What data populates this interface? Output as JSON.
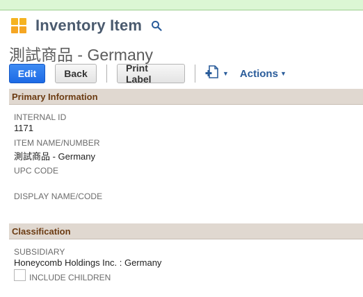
{
  "header": {
    "record_type": "Inventory Item",
    "record_title": "測試商品 - Germany"
  },
  "toolbar": {
    "edit_label": "Edit",
    "back_label": "Back",
    "print_label": "Print Label",
    "actions_label": "Actions"
  },
  "sections": {
    "primary": {
      "title": "Primary Information",
      "fields": [
        {
          "label": "INTERNAL ID",
          "value": "1171"
        },
        {
          "label": "ITEM NAME/NUMBER",
          "value": "測試商品 - Germany"
        },
        {
          "label": "UPC CODE",
          "value": ""
        },
        {
          "label": "DISPLAY NAME/CODE",
          "value": ""
        }
      ]
    },
    "classification": {
      "title": "Classification",
      "fields": [
        {
          "label": "SUBSIDIARY",
          "value": "Honeycomb Holdings Inc. : Germany"
        }
      ],
      "include_children_label": "INCLUDE CHILDREN",
      "include_children_checked": false
    }
  },
  "icons": {
    "record": "inventory-item-icon",
    "search": "search-icon",
    "new": "new-document-icon",
    "dropdown": "chevron-down-icon"
  },
  "colors": {
    "primary_button": "#1d6ae5",
    "section_header_bg": "#e0d8d0",
    "section_header_text": "#6b3b12",
    "link": "#2a5c9a",
    "record_type_text": "#4a5a6e"
  }
}
